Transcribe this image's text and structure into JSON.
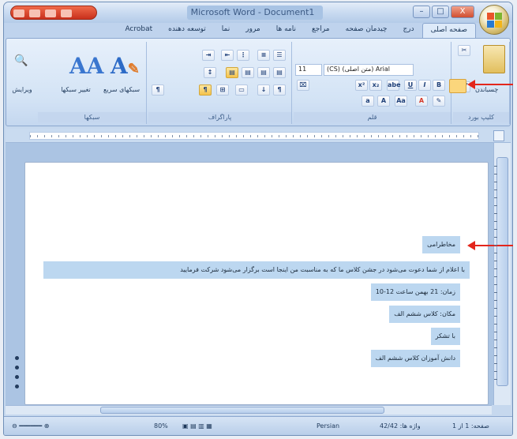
{
  "window": {
    "title": "Microsoft Word - Document1"
  },
  "titlebar": {
    "minimize": "–",
    "maximize": "□",
    "close": "X"
  },
  "tabs": [
    "صفحه اصلی",
    "درج",
    "چیدمان صفحه",
    "مراجع",
    "نامه ها",
    "مرور",
    "نما",
    "توسعه دهنده",
    "Acrobat"
  ],
  "ribbon": {
    "groups": {
      "clipboard": "کلیپ بورد",
      "font": "قلم",
      "paragraph": "پاراگراف",
      "styles": "سبکها",
      "editing": "ویرایش"
    },
    "font_name": "(CS) (متن اصلی) Arial",
    "font_size": "11",
    "clipboard_paste": "چسباندن",
    "change_styles": "تغییر سبکها",
    "quick_styles": "سبکهای سریع"
  },
  "document": {
    "lines": [
      "مخاطرامی",
      "با اعلام از شما دعوت می‌شود در جشن کلاس ما که به مناسبت من اینجا است برگزار می‌شود شرکت فرمایید",
      "زمان: 21 بهمن ساعت 12-10",
      "مکان: کلاس ششم الف",
      "با تشکر",
      "دانش آموزان کلاس ششم الف"
    ]
  },
  "statusbar": {
    "page": "صفحه: 1 از 1",
    "words": "واژه ها: 42/42",
    "language": "Persian",
    "zoom": "80%"
  },
  "colors": {
    "arrow": "#e3261c",
    "selection": "#bcd7f0",
    "accent": "#2d6bc7"
  }
}
